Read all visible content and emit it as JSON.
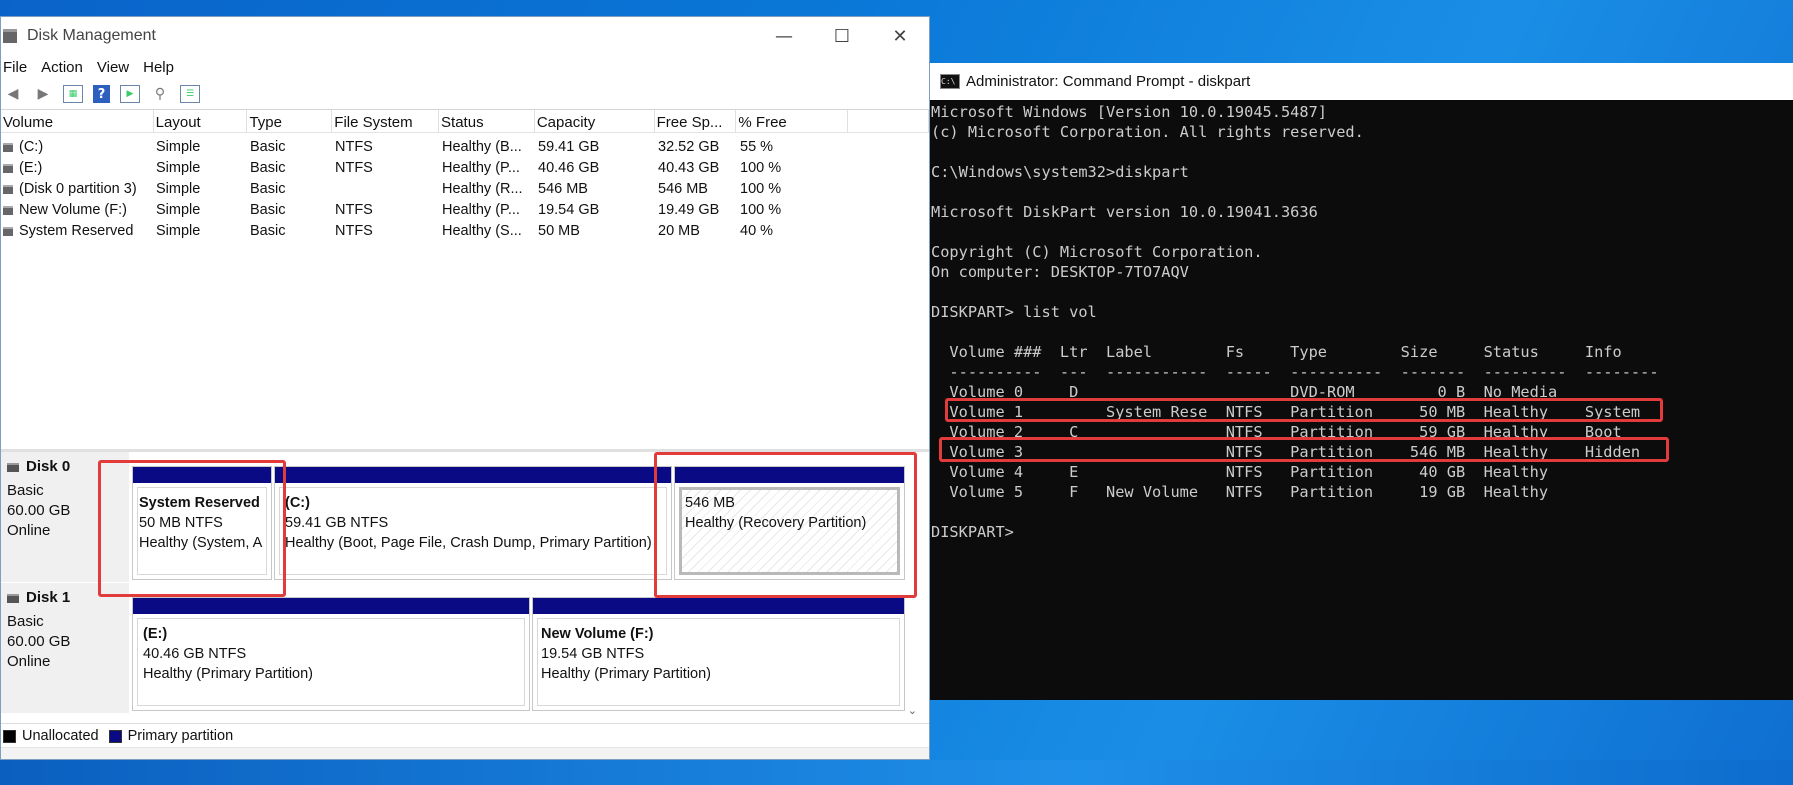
{
  "disk_management": {
    "title": "Disk Management",
    "window_buttons": {
      "minimize": "—",
      "maximize": "☐",
      "close": "✕"
    },
    "menu": [
      "File",
      "Action",
      "View",
      "Help"
    ],
    "columns": [
      "Volume",
      "Layout",
      "Type",
      "File System",
      "Status",
      "Capacity",
      "Free Sp...",
      "% Free"
    ],
    "volumes": [
      [
        "(C:)",
        "Simple",
        "Basic",
        "NTFS",
        "Healthy (B...",
        "59.41 GB",
        "32.52 GB",
        "55 %"
      ],
      [
        "(E:)",
        "Simple",
        "Basic",
        "NTFS",
        "Healthy (P...",
        "40.46 GB",
        "40.43 GB",
        "100 %"
      ],
      [
        "(Disk 0 partition 3)",
        "Simple",
        "Basic",
        "",
        "Healthy (R...",
        "546 MB",
        "546 MB",
        "100 %"
      ],
      [
        "New Volume (F:)",
        "Simple",
        "Basic",
        "NTFS",
        "Healthy (P...",
        "19.54 GB",
        "19.49 GB",
        "100 %"
      ],
      [
        "System Reserved",
        "Simple",
        "Basic",
        "NTFS",
        "Healthy (S...",
        "50 MB",
        "20 MB",
        "40 %"
      ]
    ],
    "disks": [
      {
        "name": "Disk 0",
        "kind": "Basic",
        "size": "60.00 GB",
        "state": "Online",
        "partitions": [
          {
            "name": "System Reserved",
            "size": "50 MB NTFS",
            "status": "Healthy (System, A"
          },
          {
            "name": "(C:)",
            "size": "59.41 GB NTFS",
            "status": "Healthy (Boot, Page File, Crash Dump, Primary Partition)"
          },
          {
            "name": "",
            "size": "546 MB",
            "status": "Healthy (Recovery Partition)"
          }
        ]
      },
      {
        "name": "Disk 1",
        "kind": "Basic",
        "size": "60.00 GB",
        "state": "Online",
        "partitions": [
          {
            "name": "(E:)",
            "size": "40.46 GB NTFS",
            "status": "Healthy (Primary Partition)"
          },
          {
            "name": "New Volume  (F:)",
            "size": "19.54 GB NTFS",
            "status": "Healthy (Primary Partition)"
          }
        ]
      }
    ],
    "legend": [
      {
        "label": "Unallocated",
        "color": "#000000"
      },
      {
        "label": "Primary partition",
        "color": "#0b0a85"
      }
    ]
  },
  "cmd": {
    "title": "Administrator: Command Prompt - diskpart",
    "lines": [
      "Microsoft Windows [Version 10.0.19045.5487]",
      "(c) Microsoft Corporation. All rights reserved.",
      "",
      "C:\\Windows\\system32>diskpart",
      "",
      "Microsoft DiskPart version 10.0.19041.3636",
      "",
      "Copyright (C) Microsoft Corporation.",
      "On computer: DESKTOP-7TO7AQV",
      "",
      "DISKPART> list vol",
      "",
      "  Volume ###  Ltr  Label        Fs     Type        Size     Status     Info",
      "  ----------  ---  -----------  -----  ----------  -------  ---------  --------",
      "  Volume 0     D                       DVD-ROM         0 B  No Media",
      "  Volume 1         System Rese  NTFS   Partition     50 MB  Healthy    System",
      "  Volume 2     C                NTFS   Partition     59 GB  Healthy    Boot",
      "  Volume 3                      NTFS   Partition    546 MB  Healthy    Hidden",
      "  Volume 4     E                NTFS   Partition     40 GB  Healthy",
      "  Volume 5     F   New Volume   NTFS   Partition     19 GB  Healthy",
      "",
      "DISKPART>"
    ]
  },
  "colors": {
    "highlight": "#e23b3b",
    "primary_partition": "#0b0a85",
    "console_bg": "#0c0c0c"
  }
}
